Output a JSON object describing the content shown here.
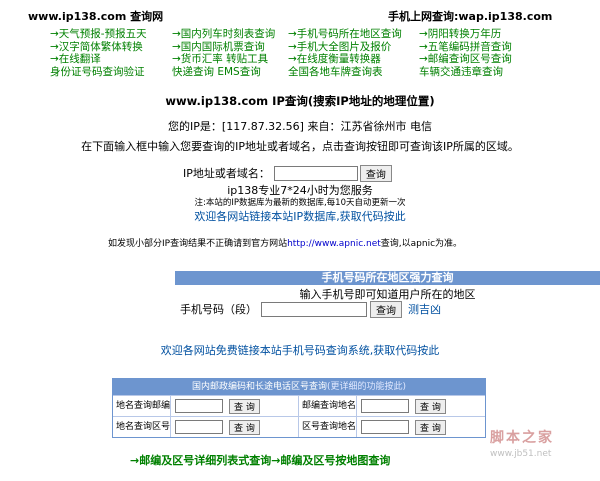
{
  "header": {
    "site_title": "www.ip138.com 查询网",
    "mobile_link": "手机上网查询:wap.ip138.com"
  },
  "nav": [
    [
      "→天气预报-预报五天",
      "→国内列车时刻表查询",
      "→手机号码所在地区查询",
      "→阴阳转换万年历"
    ],
    [
      "→汉字简体繁体转换",
      "→国内国际机票查询",
      "→手机大全图片及报价",
      "→五笔编码拼音查询"
    ],
    [
      "→在线翻译",
      "→货币汇率 转贴工具",
      "→在线度衡量转换器",
      "→邮编查询区号查询"
    ],
    [
      "身份证号码查询验证",
      "快递查询 EMS查询",
      "全国各地车牌查询表",
      "车辆交通违章查询"
    ]
  ],
  "main": {
    "heading": "www.ip138.com IP查询(搜索IP地址的地理位置)",
    "ip_line": "您的IP是：[117.87.32.56] 来自：江苏省徐州市 电信",
    "instruction": "在下面输入框中输入您要查询的IP地址或者域名，点击查询按钮即可查询该IP所属的区域。",
    "form_label": "IP地址或者域名：",
    "query_button": "查询",
    "service_line": "ip138专业7*24小时为您服务",
    "note_line": "注:本站的IP数据库为最新的数据库,每10天自动更新一次",
    "link_line": "欢迎各网站链接本站IP数据库,获取代码按此",
    "apnic_prefix": "如发现小部分IP查询结果不正确请到官方网站",
    "apnic_url": "http://www.apnic.net",
    "apnic_suffix": "查询,以apnic为准。"
  },
  "phone": {
    "header": "手机号码所在地区强力查询",
    "subtitle": "输入手机号即可知道用户所在的地区",
    "label": "手机号码（段）",
    "button": "查询",
    "ceji": "测吉凶",
    "welcome": "欢迎各网站免费链接本站手机号码查询系统,获取代码按此"
  },
  "postal": {
    "title": "国内邮政编码和长途电话区号查询",
    "title_sub": "(更详细的功能按此)",
    "rows": [
      {
        "label1": "地名查询邮编",
        "button": "查 询",
        "label2": "邮编查询地名",
        "button2": "查 询"
      },
      {
        "label1": "地名查询区号",
        "button": "查 询",
        "label2": "区号查询地名",
        "button2": "查 询"
      }
    ]
  },
  "bottom": {
    "link1": "→邮编及区号详细列表式查询",
    "link2": "→邮编及区号按地图查询"
  },
  "watermark": {
    "title": "脚本之家",
    "url": "www.jb51.net"
  }
}
